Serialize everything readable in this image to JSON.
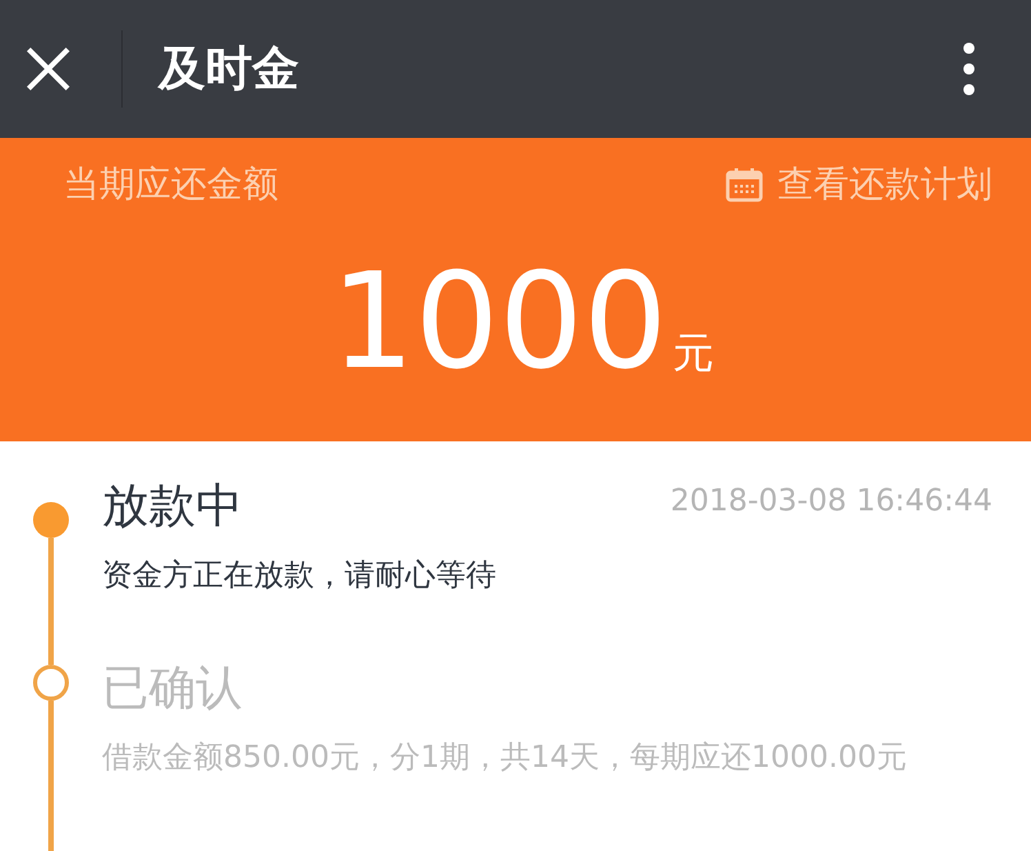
{
  "window": {
    "title": "及时金"
  },
  "summary": {
    "label": "当期应还金额",
    "plan_link": "查看还款计划",
    "amount": "1000",
    "unit": "元"
  },
  "timeline": [
    {
      "title": "放款中",
      "time": "2018-03-08 16:46:44",
      "description": "资金方正在放款，请耐心等待",
      "active": true
    },
    {
      "title": "已确认",
      "description": "借款金额850.00元，分1期，共14天，每期应还1000.00元",
      "active": false
    }
  ]
}
